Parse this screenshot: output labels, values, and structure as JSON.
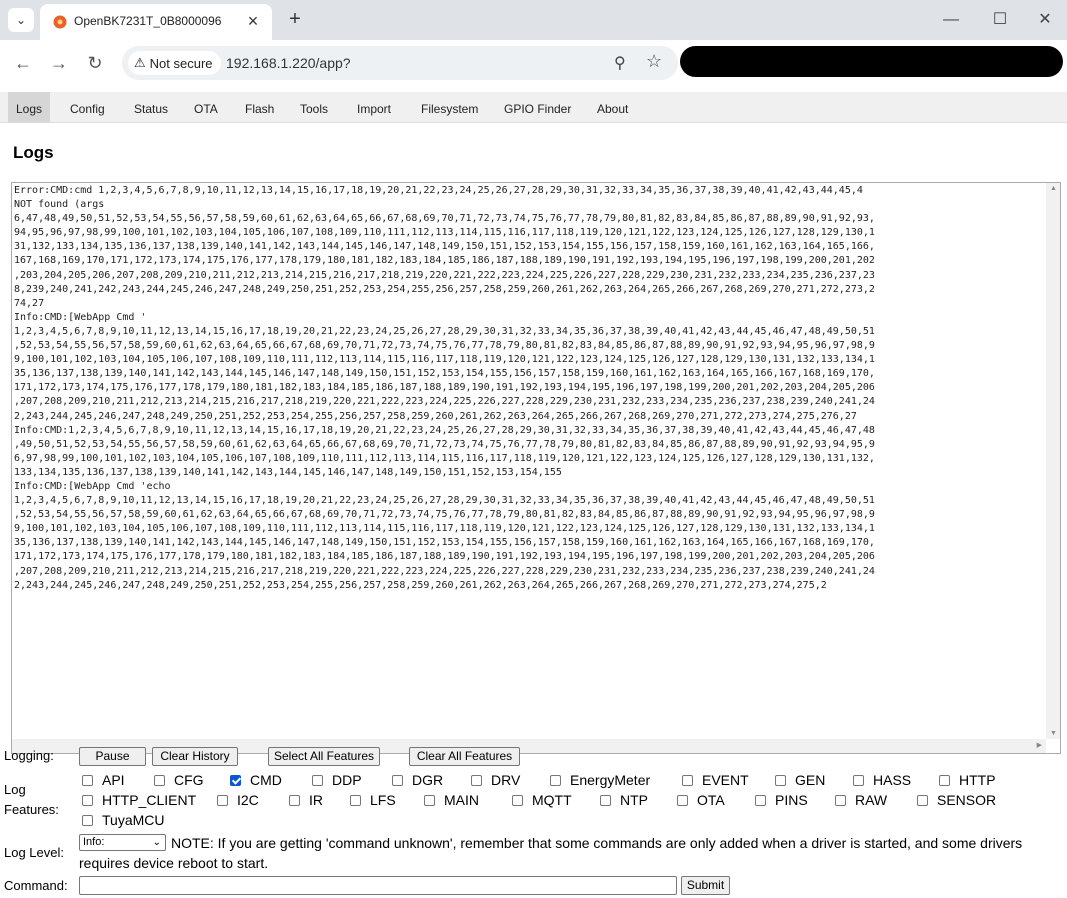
{
  "browser": {
    "tab_title": "OpenBK7231T_0B8000096",
    "security_label": "Not secure",
    "url": "192.168.1.220/app?"
  },
  "menu": [
    {
      "label": "Logs",
      "active": true
    },
    {
      "label": "Config"
    },
    {
      "label": "Status"
    },
    {
      "label": "OTA"
    },
    {
      "label": "Flash"
    },
    {
      "label": "Tools"
    },
    {
      "label": "Import"
    },
    {
      "label": "Filesystem"
    },
    {
      "label": "GPIO Finder"
    },
    {
      "label": "About"
    }
  ],
  "page_title": "Logs",
  "log_lines": [
    "Error:CMD:cmd 1,2,3,4,5,6,7,8,9,10,11,12,13,14,15,16,17,18,19,20,21,22,23,24,25,26,27,28,29,30,31,32,33,34,35,36,37,38,39,40,41,42,43,44,45,4",
    "NOT found (args",
    "6,47,48,49,50,51,52,53,54,55,56,57,58,59,60,61,62,63,64,65,66,67,68,69,70,71,72,73,74,75,76,77,78,79,80,81,82,83,84,85,86,87,88,89,90,91,92,93,",
    "94,95,96,97,98,99,100,101,102,103,104,105,106,107,108,109,110,111,112,113,114,115,116,117,118,119,120,121,122,123,124,125,126,127,128,129,130,1",
    "31,132,133,134,135,136,137,138,139,140,141,142,143,144,145,146,147,148,149,150,151,152,153,154,155,156,157,158,159,160,161,162,163,164,165,166,",
    "167,168,169,170,171,172,173,174,175,176,177,178,179,180,181,182,183,184,185,186,187,188,189,190,191,192,193,194,195,196,197,198,199,200,201,202",
    ",203,204,205,206,207,208,209,210,211,212,213,214,215,216,217,218,219,220,221,222,223,224,225,226,227,228,229,230,231,232,233,234,235,236,237,23",
    "8,239,240,241,242,243,244,245,246,247,248,249,250,251,252,253,254,255,256,257,258,259,260,261,262,263,264,265,266,267,268,269,270,271,272,273,2",
    "74,27",
    "Info:CMD:[WebApp Cmd '",
    "1,2,3,4,5,6,7,8,9,10,11,12,13,14,15,16,17,18,19,20,21,22,23,24,25,26,27,28,29,30,31,32,33,34,35,36,37,38,39,40,41,42,43,44,45,46,47,48,49,50,51",
    ",52,53,54,55,56,57,58,59,60,61,62,63,64,65,66,67,68,69,70,71,72,73,74,75,76,77,78,79,80,81,82,83,84,85,86,87,88,89,90,91,92,93,94,95,96,97,98,9",
    "9,100,101,102,103,104,105,106,107,108,109,110,111,112,113,114,115,116,117,118,119,120,121,122,123,124,125,126,127,128,129,130,131,132,133,134,1",
    "35,136,137,138,139,140,141,142,143,144,145,146,147,148,149,150,151,152,153,154,155,156,157,158,159,160,161,162,163,164,165,166,167,168,169,170,",
    "171,172,173,174,175,176,177,178,179,180,181,182,183,184,185,186,187,188,189,190,191,192,193,194,195,196,197,198,199,200,201,202,203,204,205,206",
    ",207,208,209,210,211,212,213,214,215,216,217,218,219,220,221,222,223,224,225,226,227,228,229,230,231,232,233,234,235,236,237,238,239,240,241,24",
    "2,243,244,245,246,247,248,249,250,251,252,253,254,255,256,257,258,259,260,261,262,263,264,265,266,267,268,269,270,271,272,273,274,275,276,27",
    "Info:CMD:1,2,3,4,5,6,7,8,9,10,11,12,13,14,15,16,17,18,19,20,21,22,23,24,25,26,27,28,29,30,31,32,33,34,35,36,37,38,39,40,41,42,43,44,45,46,47,48",
    ",49,50,51,52,53,54,55,56,57,58,59,60,61,62,63,64,65,66,67,68,69,70,71,72,73,74,75,76,77,78,79,80,81,82,83,84,85,86,87,88,89,90,91,92,93,94,95,9",
    "6,97,98,99,100,101,102,103,104,105,106,107,108,109,110,111,112,113,114,115,116,117,118,119,120,121,122,123,124,125,126,127,128,129,130,131,132,",
    "133,134,135,136,137,138,139,140,141,142,143,144,145,146,147,148,149,150,151,152,153,154,155",
    "Info:CMD:[WebApp Cmd 'echo",
    "1,2,3,4,5,6,7,8,9,10,11,12,13,14,15,16,17,18,19,20,21,22,23,24,25,26,27,28,29,30,31,32,33,34,35,36,37,38,39,40,41,42,43,44,45,46,47,48,49,50,51",
    ",52,53,54,55,56,57,58,59,60,61,62,63,64,65,66,67,68,69,70,71,72,73,74,75,76,77,78,79,80,81,82,83,84,85,86,87,88,89,90,91,92,93,94,95,96,97,98,9",
    "9,100,101,102,103,104,105,106,107,108,109,110,111,112,113,114,115,116,117,118,119,120,121,122,123,124,125,126,127,128,129,130,131,132,133,134,1",
    "35,136,137,138,139,140,141,142,143,144,145,146,147,148,149,150,151,152,153,154,155,156,157,158,159,160,161,162,163,164,165,166,167,168,169,170,",
    "171,172,173,174,175,176,177,178,179,180,181,182,183,184,185,186,187,188,189,190,191,192,193,194,195,196,197,198,199,200,201,202,203,204,205,206",
    ",207,208,209,210,211,212,213,214,215,216,217,218,219,220,221,222,223,224,225,226,227,228,229,230,231,232,233,234,235,236,237,238,239,240,241,24",
    "2,243,244,245,246,247,248,249,250,251,252,253,254,255,256,257,258,259,260,261,262,263,264,265,266,267,268,269,270,271,272,273,274,275,2"
  ],
  "logging": {
    "label": "Logging:",
    "pause": "Pause",
    "clear_history": "Clear History",
    "select_all": "Select All Features",
    "clear_all": "Clear All Features"
  },
  "features_label_line1": "Log",
  "features_label_line2": "Features:",
  "features": [
    {
      "name": "API",
      "checked": false
    },
    {
      "name": "CFG",
      "checked": false
    },
    {
      "name": "CMD",
      "checked": true
    },
    {
      "name": "DDP",
      "checked": false
    },
    {
      "name": "DGR",
      "checked": false
    },
    {
      "name": "DRV",
      "checked": false
    },
    {
      "name": "EnergyMeter",
      "checked": false
    },
    {
      "name": "EVENT",
      "checked": false
    },
    {
      "name": "GEN",
      "checked": false
    },
    {
      "name": "HASS",
      "checked": false
    },
    {
      "name": "HTTP",
      "checked": false
    },
    {
      "name": "HTTP_CLIENT",
      "checked": false
    },
    {
      "name": "I2C",
      "checked": false
    },
    {
      "name": "IR",
      "checked": false
    },
    {
      "name": "LFS",
      "checked": false
    },
    {
      "name": "MAIN",
      "checked": false
    },
    {
      "name": "MQTT",
      "checked": false
    },
    {
      "name": "NTP",
      "checked": false
    },
    {
      "name": "OTA",
      "checked": false
    },
    {
      "name": "PINS",
      "checked": false
    },
    {
      "name": "RAW",
      "checked": false
    },
    {
      "name": "SENSOR",
      "checked": false
    },
    {
      "name": "TuyaMCU",
      "checked": false
    }
  ],
  "log_level": {
    "label": "Log Level:",
    "selected": "Info:",
    "note": "NOTE: If you are getting 'command unknown', remember that some commands are only added when a driver is started, and some drivers requires device reboot to start."
  },
  "command": {
    "label": "Command:",
    "value": "",
    "submit": "Submit"
  }
}
